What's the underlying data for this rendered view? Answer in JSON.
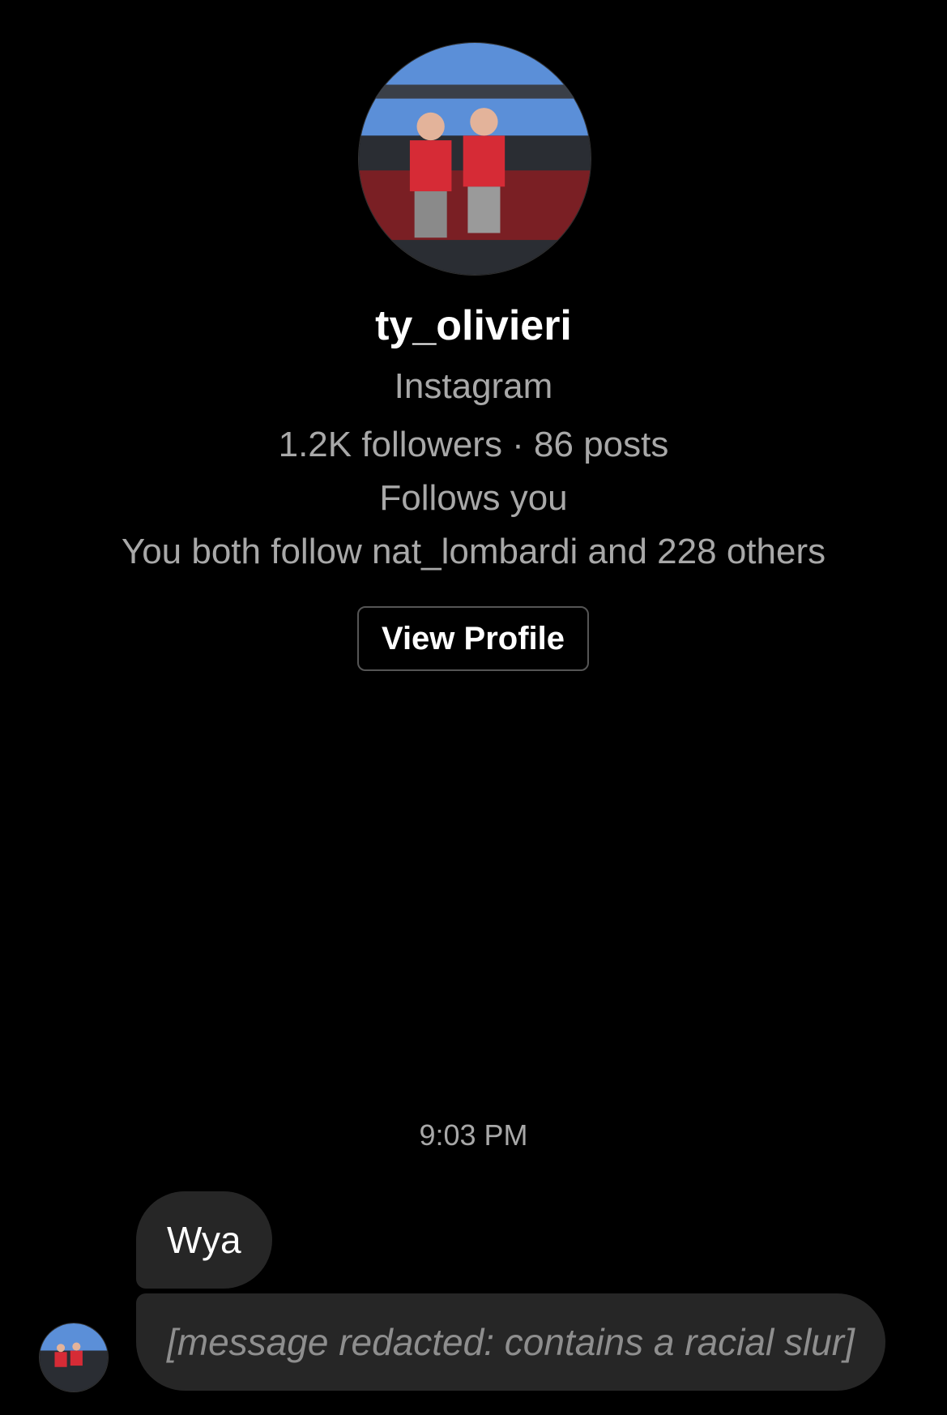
{
  "profile": {
    "username": "ty_olivieri",
    "platform": "Instagram",
    "stats": "1.2K followers · 86 posts",
    "follows_status": "Follows you",
    "mutuals": "You both follow nat_lombardi and 228 others",
    "view_profile_label": "View Profile"
  },
  "thread": {
    "timestamp": "9:03 PM",
    "messages": [
      {
        "sender": "ty_olivieri",
        "text": "Wya"
      },
      {
        "sender": "ty_olivieri",
        "text": "[message redacted: contains a racial slur]"
      }
    ]
  },
  "colors": {
    "background": "#000000",
    "bubble": "#262626",
    "secondary_text": "#a8a8a8",
    "button_border": "#555555"
  }
}
